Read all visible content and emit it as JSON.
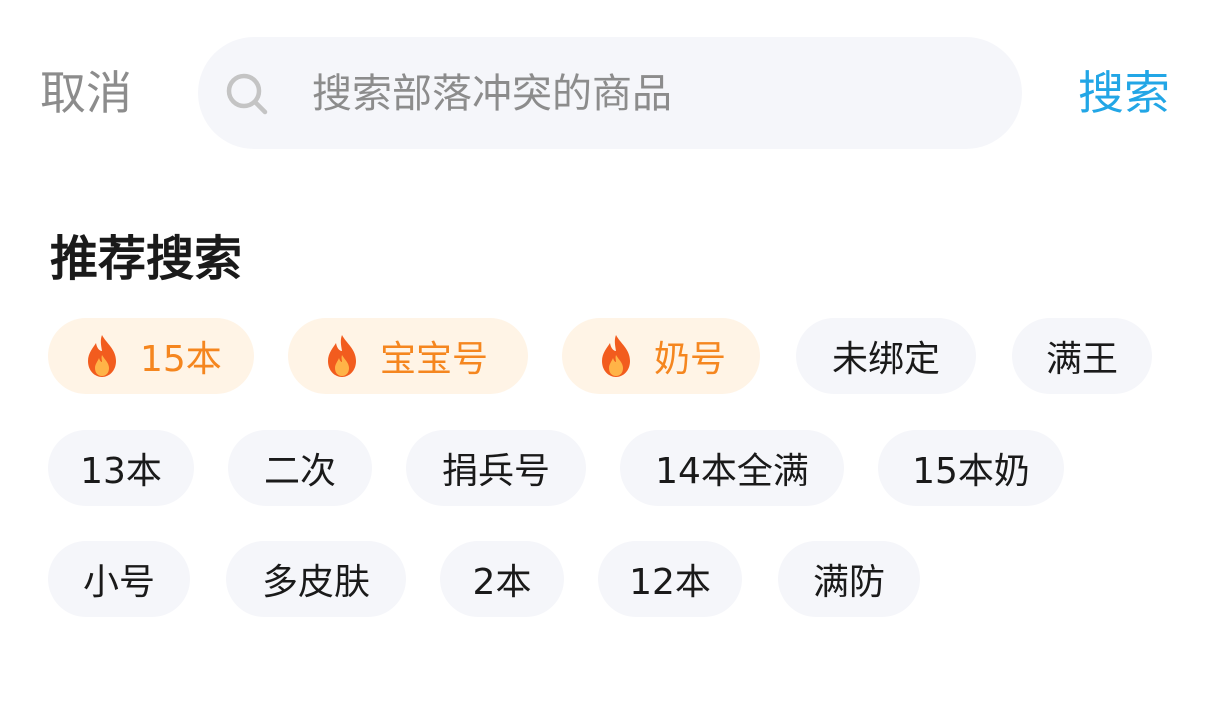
{
  "header": {
    "cancel_label": "取消",
    "search_placeholder": "搜索部落冲突的商品",
    "search_label": "搜索"
  },
  "section": {
    "title": "推荐搜索"
  },
  "chips": {
    "row1": [
      {
        "label": "15本",
        "hot": true,
        "icon": "flame-icon"
      },
      {
        "label": "宝宝号",
        "hot": true,
        "icon": "flame-icon"
      },
      {
        "label": "奶号",
        "hot": true,
        "icon": "flame-icon"
      },
      {
        "label": "未绑定",
        "hot": false
      },
      {
        "label": "满王",
        "hot": false
      }
    ],
    "row2": [
      {
        "label": "13本"
      },
      {
        "label": "二次"
      },
      {
        "label": "捐兵号"
      },
      {
        "label": "14本全满"
      },
      {
        "label": "15本奶"
      }
    ],
    "row3": [
      {
        "label": "小号"
      },
      {
        "label": "多皮肤"
      },
      {
        "label": "2本"
      },
      {
        "label": "12本"
      },
      {
        "label": "满防"
      }
    ]
  },
  "colors": {
    "accent": "#22a6e6",
    "hot_text": "#f5861f",
    "hot_bg": "#fff4e6",
    "chip_bg": "#f5f6fa"
  }
}
